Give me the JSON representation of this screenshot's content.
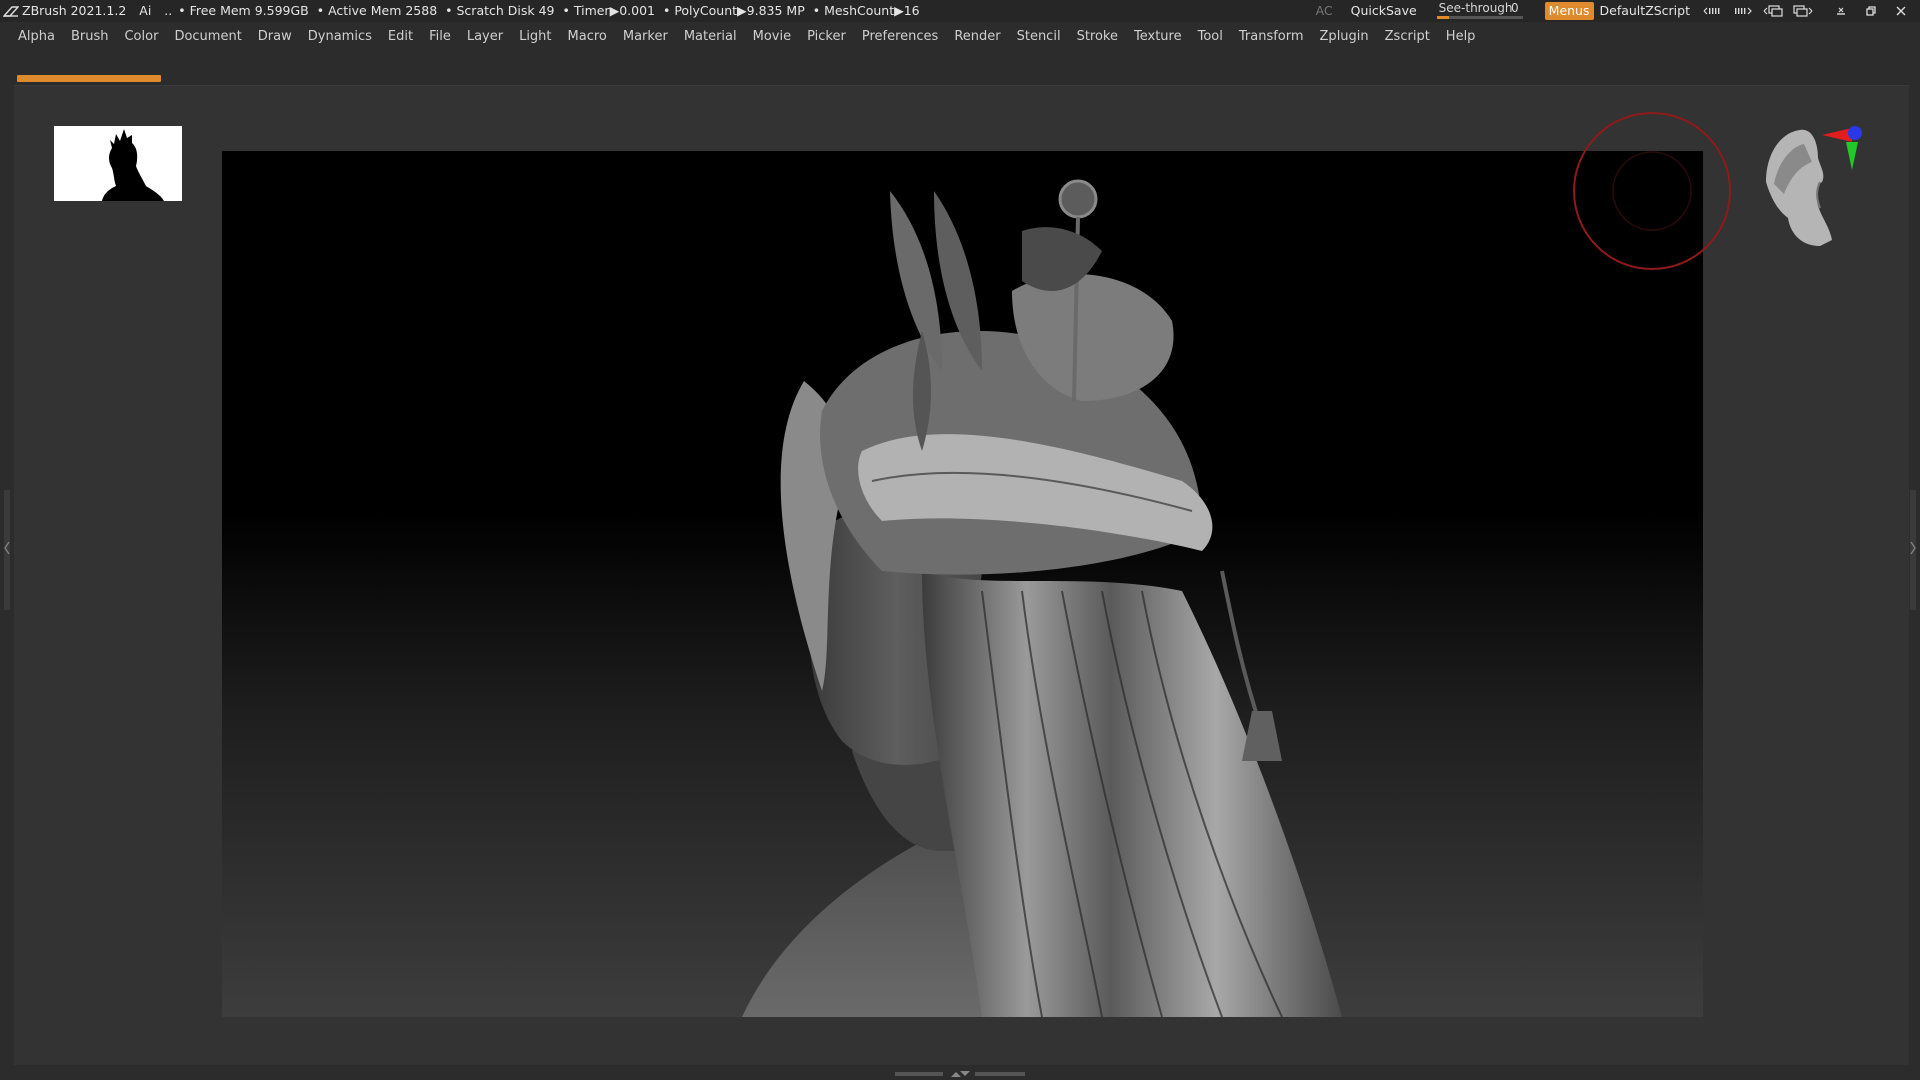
{
  "title_bar": {
    "app_name": "ZBrush 2021.1.2",
    "ai_label": "Ai",
    "dots": "..",
    "free_mem": "• Free Mem 9.599GB",
    "active_mem": "• Active Mem 2588",
    "scratch_disk": "• Scratch Disk 49",
    "timer": "• Timer▶0.001",
    "poly_count": "• PolyCount▶9.835 MP",
    "mesh_count": "• MeshCount▶16",
    "ac_label": "AC",
    "quicksave_label": "QuickSave",
    "see_through_label": "See-through",
    "see_through_value": "0",
    "menus_label": "Menus",
    "default_zscript_label": "DefaultZScript",
    "accent_color": "#e08a2e"
  },
  "menu_bar": {
    "items": [
      {
        "label": "Alpha"
      },
      {
        "label": "Brush"
      },
      {
        "label": "Color"
      },
      {
        "label": "Document"
      },
      {
        "label": "Draw"
      },
      {
        "label": "Dynamics"
      },
      {
        "label": "Edit"
      },
      {
        "label": "File"
      },
      {
        "label": "Layer"
      },
      {
        "label": "Light"
      },
      {
        "label": "Macro"
      },
      {
        "label": "Marker"
      },
      {
        "label": "Material"
      },
      {
        "label": "Movie"
      },
      {
        "label": "Picker"
      },
      {
        "label": "Preferences"
      },
      {
        "label": "Render"
      },
      {
        "label": "Stencil"
      },
      {
        "label": "Stroke"
      },
      {
        "label": "Texture"
      },
      {
        "label": "Tool"
      },
      {
        "label": "Transform"
      },
      {
        "label": "Zplugin"
      },
      {
        "label": "Zscript"
      },
      {
        "label": "Help"
      }
    ]
  },
  "icons": {
    "navigation_gizmo": "xyz-axis-gizmo-icon",
    "head_navigator": "head-navigator-icon",
    "brush_cursor": "brush-cursor-icon"
  }
}
